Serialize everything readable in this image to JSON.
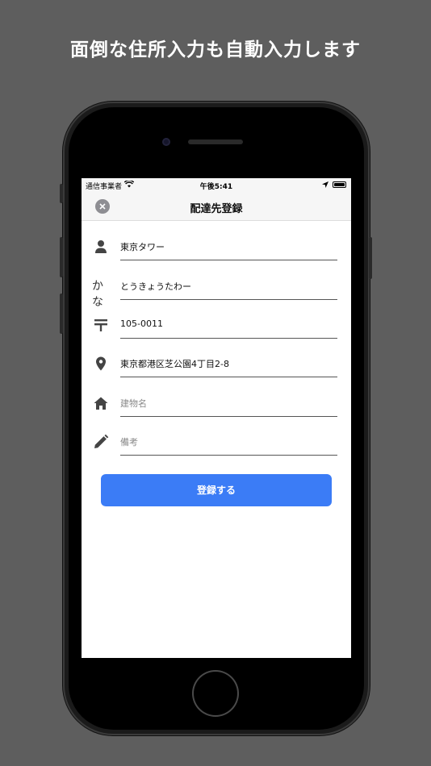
{
  "promo": {
    "title": "面倒な住所入力も自動入力します"
  },
  "status_bar": {
    "carrier": "通信事業者",
    "time": "午後5:41"
  },
  "nav": {
    "title": "配達先登録",
    "close_icon": "close-icon"
  },
  "form": {
    "fields": [
      {
        "icon": "person-icon",
        "value": "東京タワー",
        "placeholder": ""
      },
      {
        "icon": "kana-icon",
        "icon_text": "かな",
        "value": "とうきょうたわー",
        "placeholder": ""
      },
      {
        "icon": "postal-mark-icon",
        "value": "105-0011",
        "placeholder": ""
      },
      {
        "icon": "location-pin-icon",
        "value": "東京都港区芝公園4丁目2-8",
        "placeholder": ""
      },
      {
        "icon": "home-icon",
        "value": "",
        "placeholder": "建物名"
      },
      {
        "icon": "pencil-icon",
        "value": "",
        "placeholder": "備考"
      }
    ],
    "submit_label": "登録する"
  },
  "colors": {
    "accent": "#3b7cf6",
    "background": "#5e5e5e",
    "bar": "#f6f6f6"
  }
}
